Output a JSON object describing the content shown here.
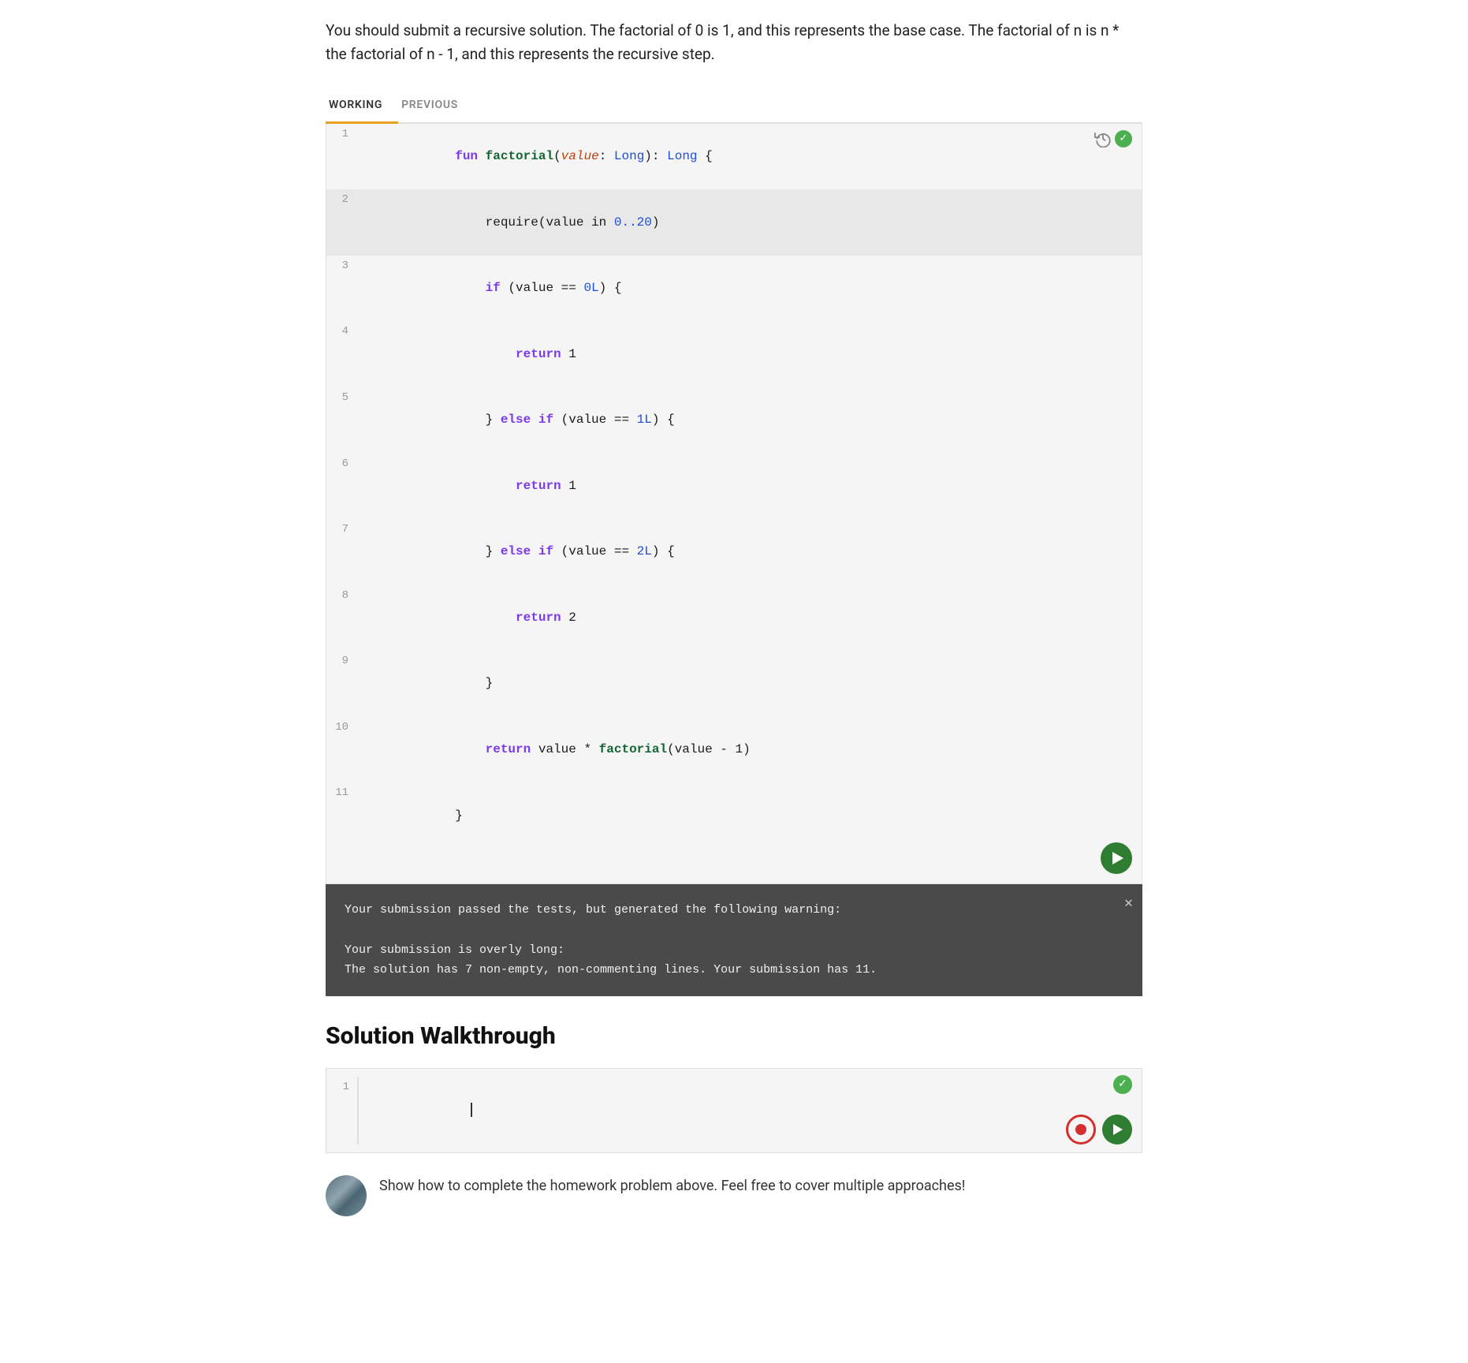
{
  "description": "You should submit a recursive solution. The factorial of 0 is 1, and this represents the base case. The factorial of n is n * the factorial of n - 1, and this represents the recursive step.",
  "tabs": [
    {
      "id": "working",
      "label": "WORKING",
      "active": true
    },
    {
      "id": "previous",
      "label": "PREVIOUS",
      "active": false
    }
  ],
  "code_editor": {
    "lines": [
      {
        "num": 1,
        "content": "fun factorial(value: Long): Long {",
        "highlighted": false
      },
      {
        "num": 2,
        "content": "    require(value in 0..20)",
        "highlighted": true
      },
      {
        "num": 3,
        "content": "    if (value == 0L) {",
        "highlighted": false
      },
      {
        "num": 4,
        "content": "        return 1",
        "highlighted": false
      },
      {
        "num": 5,
        "content": "    } else if (value == 1L) {",
        "highlighted": false
      },
      {
        "num": 6,
        "content": "        return 1",
        "highlighted": false
      },
      {
        "num": 7,
        "content": "    } else if (value == 2L) {",
        "highlighted": false
      },
      {
        "num": 8,
        "content": "        return 2",
        "highlighted": false
      },
      {
        "num": 9,
        "content": "    }",
        "highlighted": false
      },
      {
        "num": 10,
        "content": "    return value * factorial(value - 1)",
        "highlighted": false
      },
      {
        "num": 11,
        "content": "}",
        "highlighted": false
      }
    ]
  },
  "warning": {
    "line1": "Your submission passed the tests, but generated the following warning:",
    "line2": "",
    "line3": "Your submission is overly long:",
    "line4": "  The solution has 7 non-empty, non-commenting lines. Your submission has 11."
  },
  "solution_section": {
    "title": "Solution Walkthrough",
    "editor_line_num": "1",
    "editor_placeholder": ""
  },
  "user_comment": {
    "text": "Show how to complete the homework problem above. Feel free to cover multiple approaches!"
  },
  "icons": {
    "check": "✓",
    "close": "✕",
    "play": "▶"
  }
}
